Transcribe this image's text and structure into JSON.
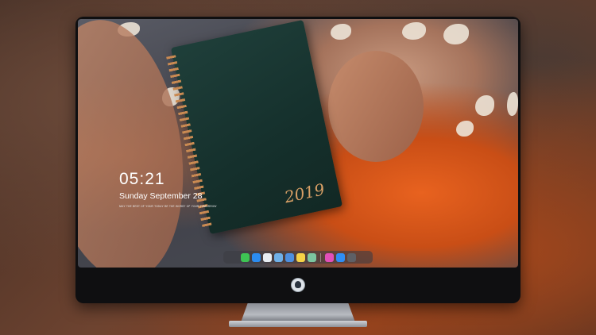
{
  "lock_screen": {
    "time": "05:21",
    "date": "Sunday September 28",
    "subtitle": "ᴍᴀʏ ᴛʜᴇ ʙᴇꜱᴛ ᴏꜰ ʏᴏᴜʀ ᴛᴏᴅᴀʏ ʙᴇ ᴛʜᴇ ᴡᴏʀꜱᴛ ᴏꜰ ʏᴏᴜʀ ᴛᴏᴍᴏʀʀᴏᴡ"
  },
  "wallpaper": {
    "notebook_text": "2019"
  },
  "dock": {
    "apps": [
      {
        "name": "messages-icon",
        "color": "#3ec454"
      },
      {
        "name": "finder-icon",
        "color": "#2b8cf0"
      },
      {
        "name": "safari-icon",
        "color": "#e9eef3"
      },
      {
        "name": "preview-icon",
        "color": "#6fb0e8"
      },
      {
        "name": "clapper-icon",
        "color": "#4d8fe0"
      },
      {
        "name": "notes-icon",
        "color": "#f6d246"
      },
      {
        "name": "photos-icon",
        "color": "#7cc5a0"
      },
      {
        "name": "itunes-icon",
        "color": "#e24fb8"
      },
      {
        "name": "app-store-icon",
        "color": "#2f8ef5"
      },
      {
        "name": "screenshot-icon",
        "color": "#5e6066"
      }
    ]
  },
  "device": {
    "chin_logo": "avatar-logo-icon"
  }
}
